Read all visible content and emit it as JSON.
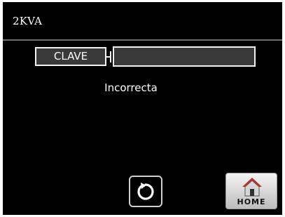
{
  "header": {
    "title": "2KVA"
  },
  "password": {
    "label": "CLAVE",
    "value": ""
  },
  "status": {
    "message": "Incorrecta"
  },
  "controls": {
    "home_label": "HOME"
  },
  "icons": {
    "refresh": "refresh-icon",
    "home": "home-icon"
  }
}
